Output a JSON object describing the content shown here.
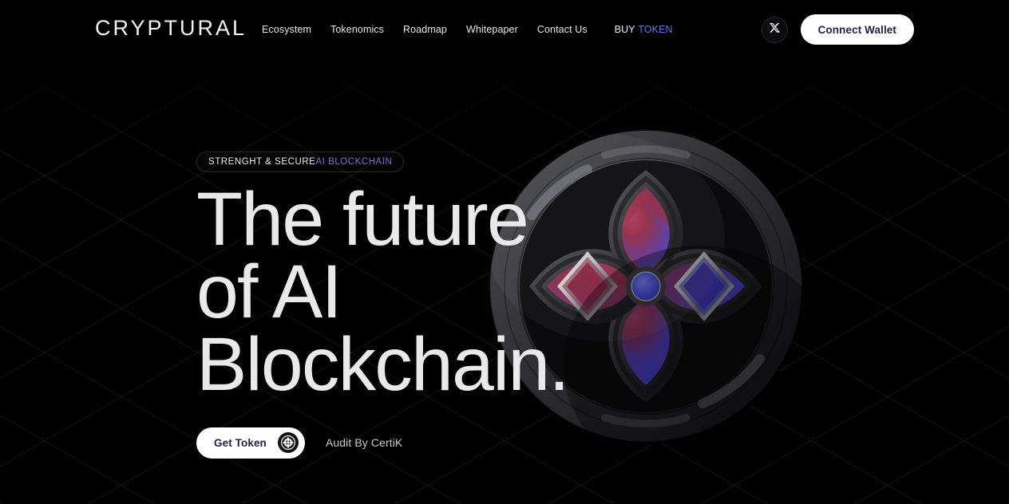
{
  "brand": {
    "logo": "CRYPTURAL"
  },
  "nav": {
    "items": [
      {
        "label": "Ecosystem"
      },
      {
        "label": "Tokenomics"
      },
      {
        "label": "Roadmap"
      },
      {
        "label": "Whitepaper"
      },
      {
        "label": "Contact Us"
      }
    ],
    "buy": {
      "word_plain": "BUY",
      "word_accent": "TOKEN"
    }
  },
  "header": {
    "social_icon": "x-twitter-icon",
    "connect_wallet_label": "Connect Wallet"
  },
  "hero": {
    "eyebrow": {
      "plain": "STRENGHT & SECURE ",
      "accent": "AI BLOCKCHAIN"
    },
    "headline_lines": [
      "The future",
      "of AI",
      "Blockchain."
    ],
    "primary_cta": {
      "label": "Get Token",
      "icon": "flower-wheel-icon"
    },
    "secondary_text": "Audit By CertiK"
  },
  "visual": {
    "name": "ai-blockchain-orb",
    "description": "Dark latticed sphere with quatrefoil petal shell, silver diamond bezels and blue core",
    "core_dot": "blue-core-dot"
  },
  "colors": {
    "background": "#000000",
    "accent_violet": "#7b6ddb",
    "text_primary": "#e9e9e9",
    "text_muted": "#c9c9c9",
    "button_bg": "#ffffff",
    "button_text": "#241f4a",
    "orb_blue": "#4a54e8",
    "orb_crimson": "#8e2a46",
    "orb_shell": "#3a3a3e"
  }
}
